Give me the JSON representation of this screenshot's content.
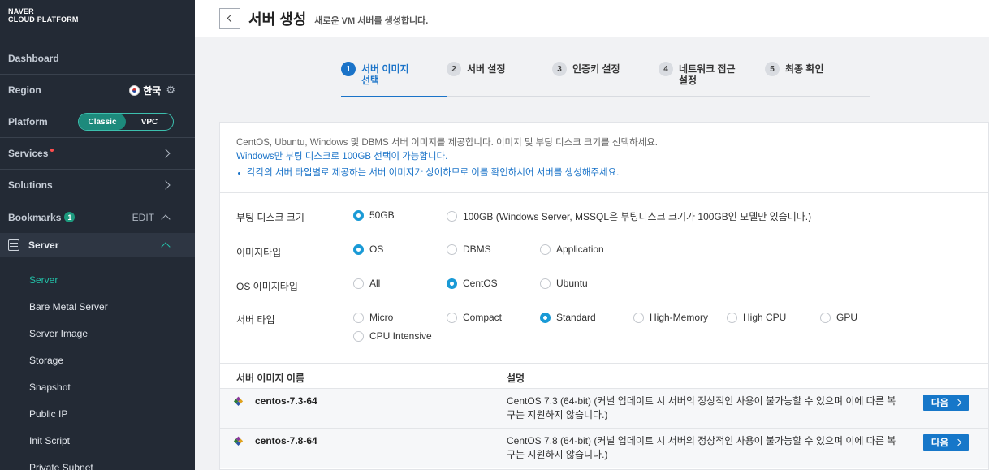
{
  "brand": {
    "line1": "NAVER",
    "line2": "CLOUD PLATFORM"
  },
  "sidebar": {
    "dashboard": "Dashboard",
    "region_label": "Region",
    "region_value": "한국",
    "platform_label": "Platform",
    "platform_options": [
      "Classic",
      "VPC"
    ],
    "platform_selected": "Classic",
    "services": "Services",
    "solutions": "Solutions",
    "bookmarks": "Bookmarks",
    "bookmarks_count": "1",
    "edit": "EDIT",
    "server_group": "Server",
    "server_items": [
      "Server",
      "Bare Metal Server",
      "Server Image",
      "Storage",
      "Snapshot",
      "Public IP",
      "Init Script",
      "Private Subnet"
    ],
    "active_item": "Server"
  },
  "header": {
    "title": "서버 생성",
    "subtitle": "새로운 VM 서버를 생성합니다."
  },
  "steps": [
    {
      "num": "1",
      "label": "서버 이미지\n선택",
      "active": true
    },
    {
      "num": "2",
      "label": "서버 설정",
      "active": false
    },
    {
      "num": "3",
      "label": "인증키 설정",
      "active": false
    },
    {
      "num": "4",
      "label": "네트워크 접근\n설정",
      "active": false
    },
    {
      "num": "5",
      "label": "최종 확인",
      "active": false
    }
  ],
  "info": {
    "line1": "CentOS, Ubuntu, Windows 및 DBMS 서버 이미지를 제공합니다. 이미지 및 부팅 디스크 크기를 선택하세요.",
    "line2": "Windows만 부팅 디스크로 100GB 선택이 가능합니다.",
    "line3": "각각의 서버 타입별로 제공하는 서버 이미지가 상이하므로 이를 확인하시어 서버를 생성해주세요."
  },
  "options": {
    "boot_disk": {
      "label": "부팅 디스크 크기",
      "choices": [
        "50GB",
        "100GB (Windows Server, MSSQL은 부팅디스크 크기가 100GB인 모델만 있습니다.)"
      ],
      "selected": 0
    },
    "image_type": {
      "label": "이미지타입",
      "choices": [
        "OS",
        "DBMS",
        "Application"
      ],
      "selected": 0
    },
    "os_image_type": {
      "label": "OS 이미지타입",
      "choices": [
        "All",
        "CentOS",
        "Ubuntu"
      ],
      "selected": 1
    },
    "server_type": {
      "label": "서버 타입",
      "choices": [
        "Micro",
        "Compact",
        "Standard",
        "High-Memory",
        "High CPU",
        "GPU",
        "CPU Intensive"
      ],
      "selected": 2
    }
  },
  "table": {
    "headers": [
      "서버 이미지 이름",
      "설명"
    ],
    "rows": [
      {
        "name": "centos-7.3-64",
        "desc": "CentOS 7.3 (64-bit) (커널 업데이트 시 서버의 정상적인 사용이 불가능할 수 있으며 이에 따른 복구는 지원하지 않습니다.)",
        "button": "다음"
      },
      {
        "name": "centos-7.8-64",
        "desc": "CentOS 7.8 (64-bit) (커널 업데이트 시 서버의 정상적인 사용이 불가능할 수 있으며 이에 따른 복구는 지원하지 않습니다.)",
        "button": "다음"
      }
    ]
  },
  "colors": {
    "sidebar_bg": "#232a35",
    "accent_blue": "#1a73c8",
    "accent_green": "#22c0a7",
    "button_blue": "#1677c9"
  }
}
